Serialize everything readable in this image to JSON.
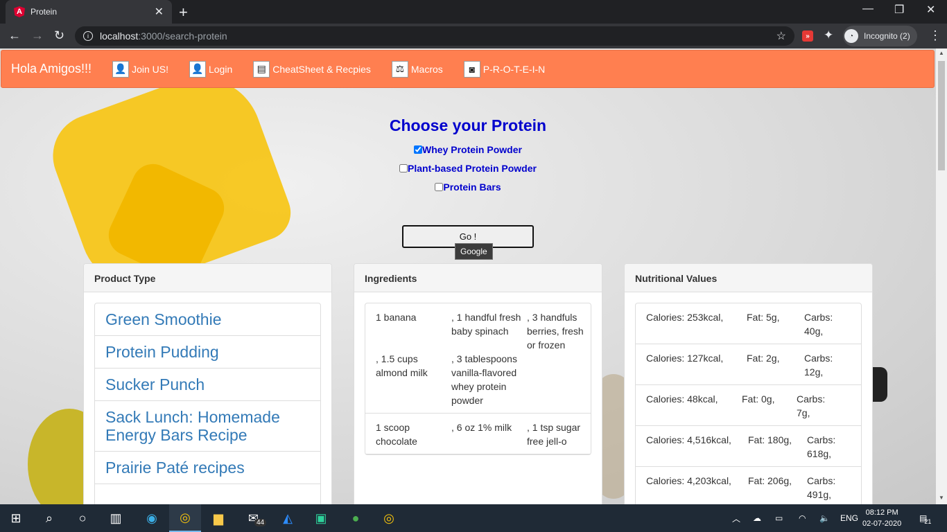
{
  "browser": {
    "tab_title": "Protein",
    "url_host": "localhost",
    "url_path": ":3000/search-protein",
    "incognito_label": "Incognito (2)"
  },
  "navbar": {
    "brand": "Hola Amigos!!!",
    "items": [
      {
        "label": "Join US!",
        "icon": "user-icon"
      },
      {
        "label": "Login",
        "icon": "user-icon"
      },
      {
        "label": "CheatSheet & Recpies",
        "icon": "book-icon"
      },
      {
        "label": "Macros",
        "icon": "scale-icon"
      },
      {
        "label": "P-R-O-T-E-I-N",
        "icon": "jar-icon"
      }
    ]
  },
  "form": {
    "heading": "Choose your Protein",
    "options": [
      {
        "label": "Whey Protein Powder",
        "checked": true
      },
      {
        "label": "Plant-based Protein Powder",
        "checked": false
      },
      {
        "label": "Protein Bars",
        "checked": false
      }
    ],
    "go_label": "Go !",
    "tooltip": "Google"
  },
  "panels": {
    "product_type": {
      "title": "Product Type",
      "items": [
        "Green Smoothie",
        "Protein Pudding",
        "Sucker Punch",
        "Sack Lunch: Homemade Energy Bars Recipe",
        "Prairie Paté recipes"
      ]
    },
    "ingredients": {
      "title": "Ingredients",
      "rows": [
        [
          "1 banana",
          ", 1 handful fresh baby spinach",
          ", 3 handfuls berries, fresh or frozen",
          ", 1.5 cups almond milk",
          ", 3 tablespoons vanilla-flavored whey protein powder",
          ""
        ],
        [
          "1 scoop chocolate",
          ", 6 oz 1% milk",
          ", 1 tsp sugar free jell-o"
        ]
      ]
    },
    "nutrition": {
      "title": "Nutritional Values",
      "rows": [
        [
          "Calories: 253kcal,",
          "Fat: 5g,",
          "Carbs: 40g,"
        ],
        [
          "Calories: 127kcal,",
          "Fat: 2g,",
          "Carbs: 12g,"
        ],
        [
          "Calories: 48kcal,",
          "Fat: 0g,",
          "Carbs: 7g,"
        ],
        [
          "Calories: 4,516kcal,",
          "Fat: 180g,",
          "Carbs: 618g,"
        ],
        [
          "Calories: 4,203kcal,",
          "Fat: 206g,",
          "Carbs: 491g,"
        ]
      ]
    }
  },
  "taskbar": {
    "mail_badge": "44",
    "language": "ENG",
    "time": "08:12 PM",
    "date": "02-07-2020",
    "notification_count": "21"
  },
  "colors": {
    "navbar": "#ff7f50",
    "heading": "#0000cd",
    "link": "#337ab7"
  }
}
